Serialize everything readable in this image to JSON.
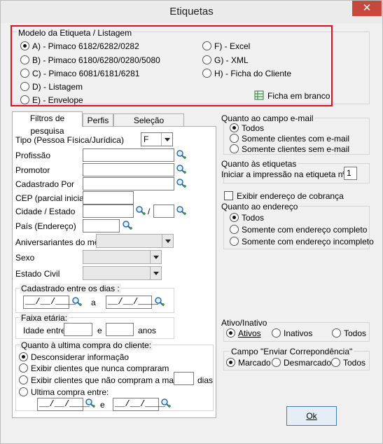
{
  "window": {
    "title": "Etiquetas",
    "close_label": "✕"
  },
  "model": {
    "legend": "Modelo da Etiqueta / Listagem",
    "options_left": [
      "A) - Pimaco 6182/6282/0282",
      "B) - Pimaco 6180/6280/0280/5080",
      "C) - Pimaco 6081/6181/6281",
      "D) - Listagem",
      "E) - Envelope"
    ],
    "options_right": [
      "F) - Excel",
      "G) - XML",
      "H) - Ficha do Cliente"
    ],
    "selected": "A) - Pimaco 6182/6282/0282",
    "ficha_label": "Ficha em branco"
  },
  "tabs": [
    "Filtros de pesquisa",
    "Perfis",
    "Seleção Específica"
  ],
  "filters": {
    "tipo_label": "Tipo (Pessoa Física/Jurídica)",
    "tipo_value": "F",
    "profissao_label": "Profissão",
    "promotor_label": "Promotor",
    "cadastrado_por_label": "Cadastrado Por",
    "cep_label": "CEP (parcial inicial)",
    "cidade_label": "Cidade / Estado",
    "cidade_sep": "/",
    "pais_label": "País (Endereço)",
    "aniversariantes_label": "Aniversariantes do mês",
    "sexo_label": "Sexo",
    "estado_civil_label": "Estado Civil",
    "cadastrado_entre_legend": "Cadastrado entre os dias :",
    "date_mask": "__/__/____",
    "a_label": "a",
    "faixa_legend": "Faixa etária:",
    "idade_entre_label": "Idade entre",
    "e_label": "e",
    "anos_label": "anos",
    "ultima_compra_legend": "Quanto à ultima compra do cliente:",
    "ultima_options": [
      "Desconsiderar informação",
      "Exibir clientes que nunca compraram",
      "Exibir clientes que não compram a mais de",
      "Ultima compra entre:"
    ],
    "dias_label": "dias"
  },
  "email": {
    "legend": "Quanto ao campo e-mail",
    "options": [
      "Todos",
      "Somente clientes com e-mail",
      "Somente clientes sem e-mail"
    ]
  },
  "etiquetas": {
    "legend": "Quanto às etiquetas",
    "iniciar_label": "Iniciar a impressão na etiqueta nº",
    "iniciar_value": "1"
  },
  "endereco": {
    "cobranca_label": "Exibir endereço de cobrança",
    "legend": "Quanto ao endereço",
    "options": [
      "Todos",
      "Somente com endereço completo",
      "Somente com endereço incompleto"
    ]
  },
  "ativo": {
    "legend": "Ativo/Inativo",
    "options": [
      "Ativos",
      "Inativos",
      "Todos"
    ]
  },
  "correspondencia": {
    "legend": "Campo \"Enviar Correpondência\"",
    "options": [
      "Marcado",
      "Desmarcado",
      "Todos"
    ]
  },
  "ok_label": "Ok"
}
